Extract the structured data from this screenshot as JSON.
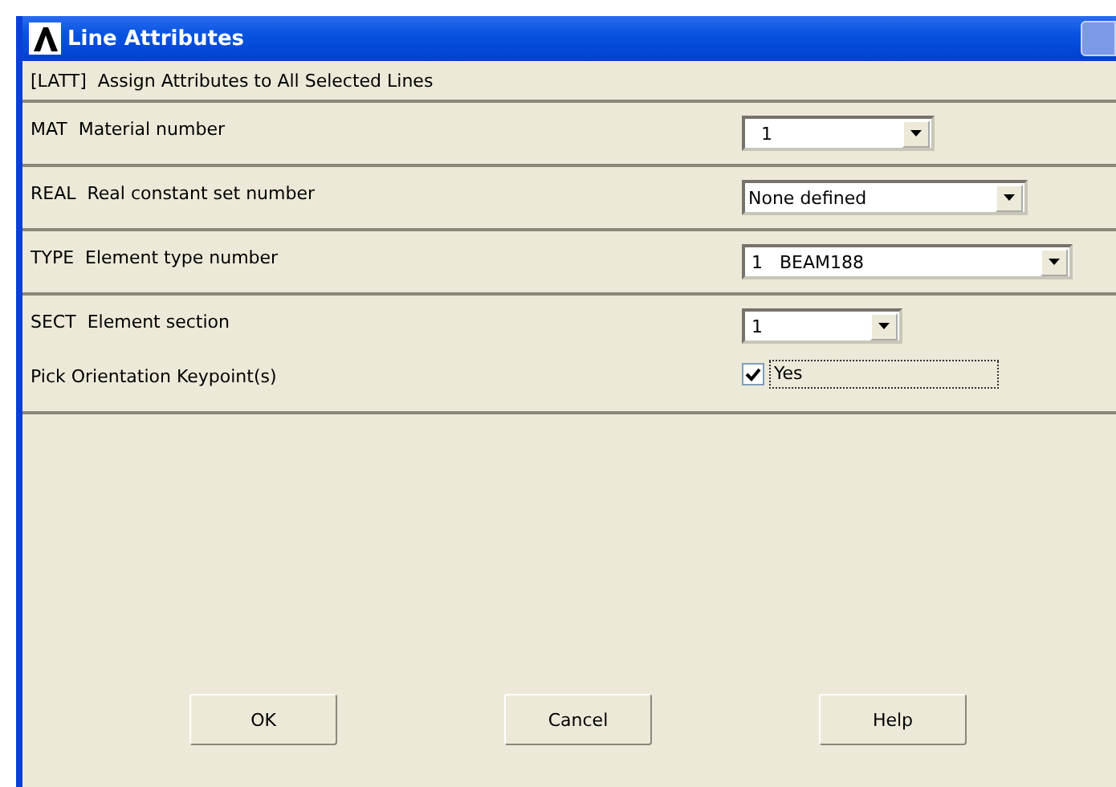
{
  "window": {
    "title": "Line Attributes",
    "command": "[LATT]  Assign Attributes to All Selected Lines"
  },
  "sections": [
    {
      "rows": [
        {
          "kind": "dropdown",
          "label": "MAT  Material number",
          "value": "1"
        }
      ]
    },
    {
      "rows": [
        {
          "kind": "dropdown",
          "label": "REAL  Real constant set number",
          "value": "None defined"
        }
      ]
    },
    {
      "rows": [
        {
          "kind": "dropdown",
          "label": "TYPE  Element type number",
          "value": "1   BEAM188"
        }
      ]
    },
    {
      "rows": [
        {
          "kind": "dropdown",
          "label": "SECT  Element section",
          "value": "1"
        },
        {
          "kind": "checkbox",
          "label": "Pick Orientation Keypoint(s)",
          "value": "Yes",
          "checked": true
        }
      ]
    }
  ],
  "buttons": [
    "OK",
    "Cancel",
    "Help"
  ]
}
